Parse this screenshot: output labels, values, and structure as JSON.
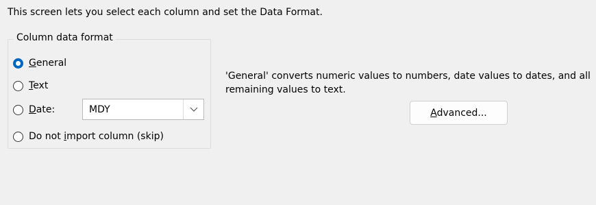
{
  "intro_text": "This screen lets you select each column and set the Data Format.",
  "column_format": {
    "title": "Column data format",
    "options": [
      {
        "label": "General",
        "accel": "G",
        "checked": true
      },
      {
        "label": "Text",
        "accel": "T",
        "checked": false
      },
      {
        "label": "Date:",
        "accel": "D",
        "checked": false
      },
      {
        "label": "Do not import column (skip)",
        "accel": "i",
        "checked": false
      }
    ],
    "date_select": {
      "value": "MDY"
    }
  },
  "description": "'General' converts numeric values to numbers, date values to dates, and all remaining values to text.",
  "advanced_button": {
    "label": "Advanced...",
    "accel": "A"
  },
  "colors": {
    "background": "#f0f0f0",
    "accent": "#0067c0"
  },
  "icons": {
    "select_arrow": "chevron-down-icon"
  }
}
